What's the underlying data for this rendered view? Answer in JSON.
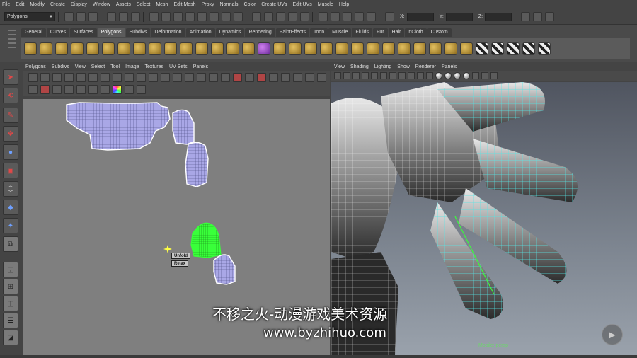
{
  "menubar": [
    "File",
    "Edit",
    "Modify",
    "Create",
    "Display",
    "Window",
    "Assets",
    "Select",
    "Mesh",
    "Edit Mesh",
    "Proxy",
    "Normals",
    "Color",
    "Create UVs",
    "Edit UVs",
    "Muscle",
    "Help"
  ],
  "statusline": {
    "mode": "Polygons",
    "x_label": "X:",
    "y_label": "Y:",
    "z_label": "Z:"
  },
  "shelf": {
    "tabs": [
      "General",
      "Curves",
      "Surfaces",
      "Polygons",
      "Subdivs",
      "Deformation",
      "Animation",
      "Dynamics",
      "Rendering",
      "PaintEffects",
      "Toon",
      "Muscle",
      "Fluids",
      "Fur",
      "Hair",
      "nCloth",
      "Custom"
    ],
    "active_tab": "Polygons"
  },
  "uv_editor": {
    "menu": [
      "Polygons",
      "Subdivs",
      "View",
      "Select",
      "Tool",
      "Image",
      "Textures",
      "UV Sets",
      "Panels"
    ],
    "popup_unfold": "Unfold",
    "popup_relax": "Relax"
  },
  "viewport": {
    "menu": [
      "View",
      "Shading",
      "Lighting",
      "Show",
      "Renderer",
      "Panels"
    ],
    "camera_label": "Mobile: persp"
  },
  "watermark": {
    "title": "不移之火-动漫游戏美术资源",
    "url": "www.byzhihuo.com"
  },
  "colors": {
    "uv_shell": "#a9a7e6",
    "uv_selected": "#39ff3a",
    "uv_canvas": "#7f7f7f",
    "wire": "#55e6e6"
  }
}
